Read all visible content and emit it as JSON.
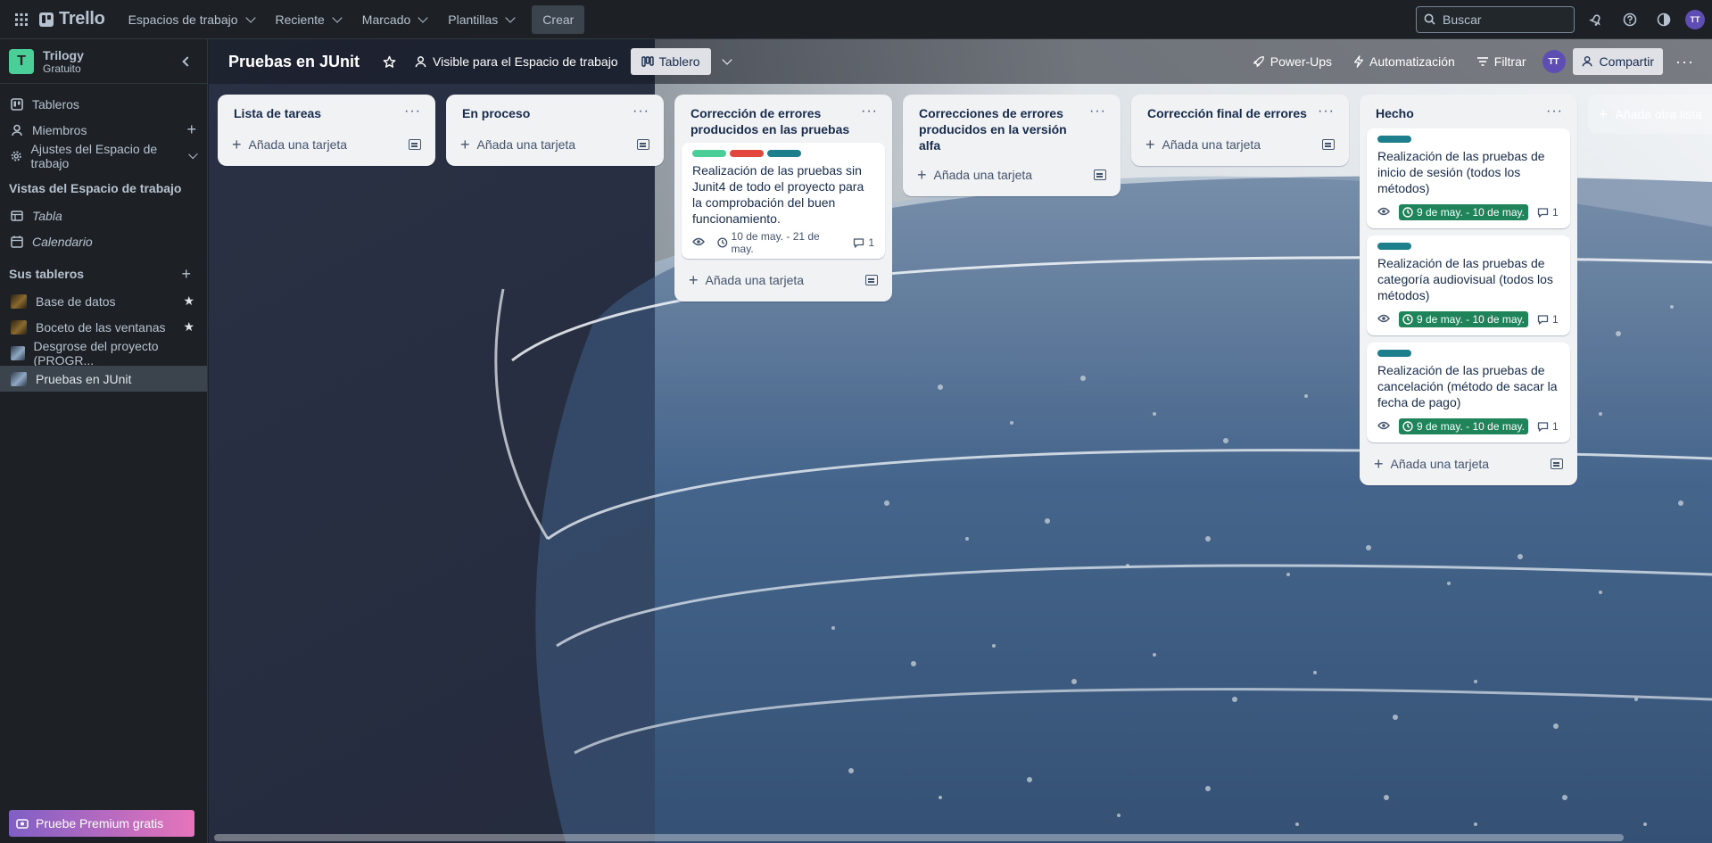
{
  "topnav": {
    "brand": "Trello",
    "menus": [
      "Espacios de trabajo",
      "Reciente",
      "Marcado",
      "Plantillas"
    ],
    "create_label": "Crear",
    "search_placeholder": "Buscar",
    "user_initials": "TT",
    "icons": [
      "apps-grid-icon",
      "bell-icon",
      "help-icon",
      "theme-icon"
    ]
  },
  "sidebar": {
    "workspace_initial": "T",
    "workspace_name": "Trilogy",
    "workspace_plan": "Gratuito",
    "items": [
      {
        "label": "Tableros",
        "icon": "boards-icon"
      },
      {
        "label": "Miembros",
        "icon": "member-icon"
      },
      {
        "label": "Ajustes del Espacio de trabajo",
        "icon": "gear-icon"
      }
    ],
    "views_heading": "Vistas del Espacio de trabajo",
    "views": [
      {
        "label": "Tabla",
        "icon": "table-icon"
      },
      {
        "label": "Calendario",
        "icon": "calendar-icon"
      }
    ],
    "boards_heading": "Sus tableros",
    "boards": [
      {
        "label": "Base de datos",
        "starred": true,
        "color": "#6b5a2a"
      },
      {
        "label": "Boceto de las ventanas",
        "starred": true,
        "color": "#6b5a2a"
      },
      {
        "label": "Desgrose del proyecto (PROGR...",
        "starred": false,
        "color": "#5b7fa6"
      },
      {
        "label": "Pruebas en JUnit",
        "starred": false,
        "color": "#5b7fa6"
      }
    ],
    "premium_label": "Pruebe Premium gratis"
  },
  "board": {
    "title": "Pruebas en JUnit",
    "visibility": "Visible para el Espacio de trabajo",
    "view_label": "Tablero",
    "powerups": "Power-Ups",
    "automation": "Automatización",
    "filter": "Filtrar",
    "share": "Compartir",
    "add_list": "Añada otra lista",
    "add_card": "Añada una tarjeta",
    "lists": [
      {
        "title": "Lista de tareas",
        "cards": []
      },
      {
        "title": "En proceso",
        "cards": []
      },
      {
        "title": "Corrección de errores producidos en las pruebas",
        "cards": [
          {
            "labels": [
              "#4bce97",
              "#e2483d",
              "#1d7f8c"
            ],
            "text": "Realización de las pruebas sin Junit4 de todo el proyecto para la comprobación del buen funcionamiento.",
            "date": "10 de may. - 21 de may.",
            "done": false,
            "comments": "1"
          }
        ]
      },
      {
        "title": "Correcciones de errores producidos en la versión alfa",
        "cards": []
      },
      {
        "title": "Corrección final de errores",
        "cards": []
      },
      {
        "title": "Hecho",
        "cards": [
          {
            "labels": [
              "#1d7f8c"
            ],
            "text": "Realización de las pruebas de inicio de sesión (todos los métodos)",
            "date": "9 de may. - 10 de may.",
            "done": true,
            "comments": "1"
          },
          {
            "labels": [
              "#1d7f8c"
            ],
            "text": "Realización de las pruebas de categoría audiovisual (todos los métodos)",
            "date": "9 de may. - 10 de may.",
            "done": true,
            "comments": "1"
          },
          {
            "labels": [
              "#1d7f8c"
            ],
            "text": "Realización de las pruebas de cancelación (método de sacar la fecha de pago)",
            "date": "9 de may. - 10 de may.",
            "done": true,
            "comments": "1"
          }
        ]
      }
    ]
  }
}
